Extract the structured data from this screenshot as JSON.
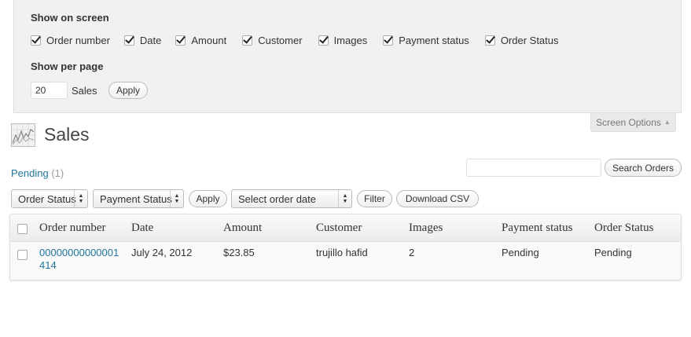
{
  "screen_options": {
    "show_on_screen_heading": "Show on screen",
    "columns": [
      {
        "label": "Order number",
        "checked": true
      },
      {
        "label": "Date",
        "checked": true
      },
      {
        "label": "Amount",
        "checked": true
      },
      {
        "label": "Customer",
        "checked": true
      },
      {
        "label": "Images",
        "checked": true
      },
      {
        "label": "Payment status",
        "checked": true
      },
      {
        "label": "Order Status",
        "checked": true
      }
    ],
    "show_per_page_heading": "Show per page",
    "per_page_value": "20",
    "per_page_label": "Sales",
    "apply_label": "Apply",
    "tab_label": "Screen Options",
    "tab_arrow": "▲"
  },
  "page": {
    "title": "Sales",
    "pending_link": "Pending",
    "pending_count": "(1)",
    "search_button": "Search Orders"
  },
  "filters": {
    "order_status": "Order Status",
    "payment_status": "Payment Status",
    "apply_label": "Apply",
    "order_date": "Select order date",
    "filter_label": "Filter",
    "download_csv": "Download CSV"
  },
  "table": {
    "headers": [
      "Order number",
      "Date",
      "Amount",
      "Customer",
      "Images",
      "Payment status",
      "Order Status"
    ],
    "rows": [
      {
        "order_number_line1": "00000000000001",
        "order_number_line2": "414",
        "date": "July 24, 2012",
        "amount": "$23.85",
        "customer": "trujillo hafid",
        "images": "2",
        "payment_status": "Pending",
        "order_status": "Pending"
      }
    ]
  }
}
